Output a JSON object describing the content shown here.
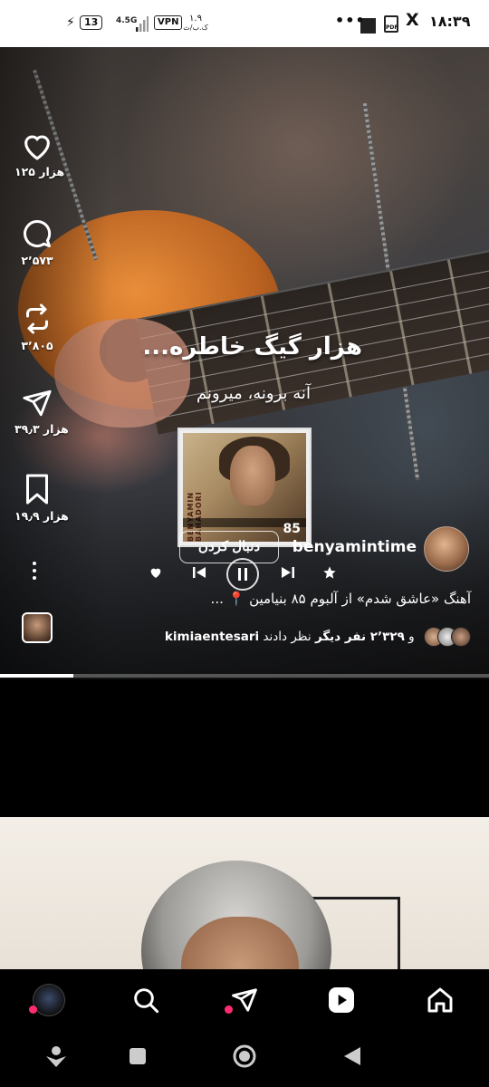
{
  "status_bar": {
    "time": "۱۸:۳۹",
    "x_label": "X",
    "pdf_label": "PDF",
    "more": "•••",
    "net_speed": "۱.۹",
    "net_unit": "ک.ب/ث",
    "vpn": "VPN",
    "network": "4.5G",
    "battery": "13"
  },
  "reel": {
    "title": "هزار گیگ خاطره...",
    "subtitle": "آنه برونه، میرونم",
    "album": {
      "spine_text": "BENYAMIN BAHADORI",
      "number": "85"
    },
    "actions": [
      {
        "name": "like",
        "count": "۱۲۵ هزار"
      },
      {
        "name": "comment",
        "count": "۲٬۵۷۳"
      },
      {
        "name": "repost",
        "count": "۳٬۸۰۵"
      },
      {
        "name": "share",
        "count": "۳۹٫۳ هزار"
      },
      {
        "name": "save",
        "count": "۱۹٫۹ هزار"
      }
    ],
    "username": "benyamintime",
    "follow_label": "دنبال کردن",
    "caption": "آهنگ «عاشق شدم» از آلبوم ۸۵ بنیامین 📍 ...",
    "comments_user": "kimiaentesari",
    "comments_and": "و",
    "comments_count": "۲٬۳۲۹ نفر دیگر",
    "comments_suffix": "نظر دادند",
    "progress": 0.15
  },
  "bottom_nav": {
    "items": [
      "profile",
      "search",
      "messages",
      "reels",
      "home"
    ]
  },
  "system_nav": {
    "buttons": [
      "assistant",
      "recents",
      "home",
      "back"
    ]
  },
  "colors": {
    "notification_dot": "#ff2d6f",
    "background": "#000000"
  }
}
